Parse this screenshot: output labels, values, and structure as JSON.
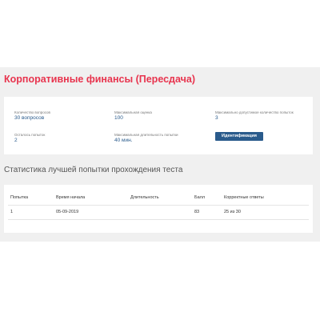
{
  "page": {
    "title": "Корпоративные финансы (Пересдача)"
  },
  "info": {
    "questions_count_label": "Количество вопросов",
    "questions_count_value": "30 вопросов",
    "max_score_label": "Максимальная оценка",
    "max_score_value": "100",
    "max_attempts_label": "Максимально допустимое количество попыток",
    "max_attempts_value": "3",
    "attempts_left_label": "Осталось попыток",
    "attempts_left_value": "2",
    "max_duration_label": "Максимальная длительность попытки",
    "max_duration_value": "40 мин.",
    "identify_button": "Идентификация"
  },
  "stats": {
    "title": "Статистика лучшей попытки прохождения теста",
    "headers": {
      "attempt": "Попытка",
      "start_time": "Время начала",
      "duration": "Длительность",
      "score": "Балл",
      "correct": "Корректные ответы"
    },
    "rows": [
      {
        "attempt": "1",
        "start_time": "05-09-2019",
        "duration": "",
        "score": "83",
        "correct": "25 из 30"
      }
    ]
  },
  "colors": {
    "title_accent": "#e8344e",
    "value_blue": "#2a5b8c",
    "button_bg": "#2a5b8c",
    "page_bg": "#f0f0f0"
  }
}
